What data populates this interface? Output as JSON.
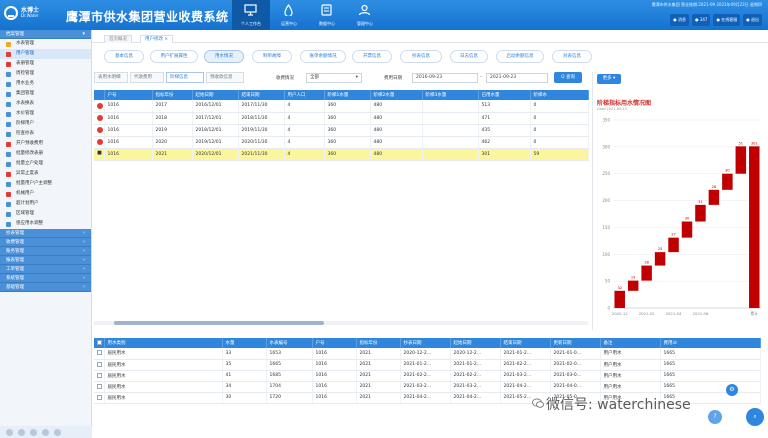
{
  "header": {
    "logo_cn": "水博士",
    "logo_en": "Dr.Water",
    "app_title": "鹰潭市供水集团营业收费系统",
    "nav": [
      {
        "label": "个人工作台",
        "icon": "monitor-icon",
        "active": true
      },
      {
        "label": "运营中心",
        "icon": "water-drop-icon",
        "active": false
      },
      {
        "label": "数据中心",
        "icon": "database-icon",
        "active": false
      },
      {
        "label": "管理中心",
        "icon": "users-icon",
        "active": false
      }
    ],
    "info_text": "鹰潭市供水集团  营业账期:2021-09  2021年09月23日 星期四",
    "buttons": [
      {
        "label": "消息",
        "icon": "bell-icon"
      },
      {
        "label": "347",
        "icon": "mail-icon"
      },
      {
        "label": "在线客服",
        "icon": "headset-icon"
      },
      {
        "label": "退出",
        "icon": "power-icon"
      }
    ]
  },
  "sidebar": {
    "sections_top": [
      {
        "label": "档案管理",
        "arrow": "▾"
      }
    ],
    "items": [
      {
        "label": "水表管理",
        "active": false,
        "color": "#f5a623"
      },
      {
        "label": "用户管理",
        "active": true,
        "color": "#e53935"
      },
      {
        "label": "表册管理",
        "active": false,
        "color": "#e53935"
      },
      {
        "label": "周检管理",
        "active": false,
        "color": "#4a90d9"
      },
      {
        "label": "用水业务",
        "active": false,
        "color": "#4a90d9"
      },
      {
        "label": "集团管理",
        "active": false,
        "color": "#4a90d9"
      },
      {
        "label": "水表换表",
        "active": false,
        "color": "#4a90d9"
      },
      {
        "label": "水价管理",
        "active": false,
        "color": "#4a90d9"
      },
      {
        "label": "阶梯用户",
        "active": false,
        "color": "#4a90d9"
      },
      {
        "label": "检查抄表",
        "active": false,
        "color": "#4a90d9"
      },
      {
        "label": "开户预收费用",
        "active": false,
        "color": "#e53935"
      },
      {
        "label": "批量修改表册",
        "active": false,
        "color": "#4a90d9"
      },
      {
        "label": "批量立户处理",
        "active": false,
        "color": "#4a90d9"
      },
      {
        "label": "异常止度表",
        "active": false,
        "color": "#e53935"
      },
      {
        "label": "批量用户户主调整",
        "active": false,
        "color": "#4a90d9"
      },
      {
        "label": "机械用户",
        "active": false,
        "color": "#e53935"
      },
      {
        "label": "超计划用户",
        "active": false,
        "color": "#4a90d9"
      },
      {
        "label": "区域管理",
        "active": false,
        "color": "#4a90d9"
      },
      {
        "label": "感应用水调整",
        "active": false,
        "color": "#4a90d9"
      }
    ],
    "sections_bottom": [
      {
        "label": "抄表管理",
        "arrow": "‹"
      },
      {
        "label": "收费管理",
        "arrow": "‹"
      },
      {
        "label": "账务管理",
        "arrow": "‹"
      },
      {
        "label": "报表管理",
        "arrow": "‹"
      },
      {
        "label": "工单管理",
        "arrow": "‹"
      },
      {
        "label": "系统管理",
        "arrow": "‹"
      },
      {
        "label": "基础管理",
        "arrow": "‹"
      }
    ]
  },
  "page_tabs": [
    {
      "label": "首页概况",
      "active": false
    },
    {
      "label": "用户修改 ×",
      "active": true
    }
  ],
  "pills": [
    {
      "label": "基本信息",
      "active": false
    },
    {
      "label": "用户扩展属性",
      "active": false
    },
    {
      "label": "用水情况",
      "active": true
    },
    {
      "label": "制单故障",
      "active": false
    },
    {
      "label": "账单余额情况",
      "active": false
    },
    {
      "label": "开票信息",
      "active": false
    },
    {
      "label": "抄表信息",
      "active": false
    },
    {
      "label": "日志信息",
      "active": false
    },
    {
      "label": "启动余额信息",
      "active": false
    },
    {
      "label": "对表信息",
      "active": false
    }
  ],
  "subtabs": [
    {
      "label": "表用水明细",
      "active": false
    },
    {
      "label": "代收费用",
      "active": false
    },
    {
      "label": "阶梯信息",
      "active": true
    },
    {
      "label": "预收款信息",
      "active": false
    }
  ],
  "filters": {
    "status_label": "收费情况",
    "status_value": "全部",
    "date_label": "费用日期",
    "date_from": "2016-09-23",
    "date_sep": "-",
    "date_to": "2021-09-23",
    "query_label": "Q 查询"
  },
  "main_table": {
    "headers": [
      "",
      "户号",
      "指标年份",
      "起始日期",
      "结束日期",
      "用户人口",
      "阶梯1水量",
      "阶梯2水量",
      "阶梯3水量",
      "已用水量",
      "阶梯水"
    ],
    "rows": [
      {
        "status": "red",
        "cells": [
          "1016",
          "2017",
          "2016/12/01",
          "2017/11/30",
          "4",
          "360",
          "480",
          "",
          "513",
          "0"
        ],
        "highlight": false
      },
      {
        "status": "red",
        "cells": [
          "1016",
          "2018",
          "2017/12/01",
          "2018/11/30",
          "4",
          "360",
          "480",
          "",
          "471",
          "0"
        ],
        "highlight": false
      },
      {
        "status": "red",
        "cells": [
          "1016",
          "2019",
          "2018/12/01",
          "2019/11/30",
          "4",
          "360",
          "480",
          "",
          "435",
          "0"
        ],
        "highlight": false
      },
      {
        "status": "red",
        "cells": [
          "1016",
          "2020",
          "2019/12/01",
          "2020/11/30",
          "4",
          "360",
          "480",
          "",
          "462",
          "0"
        ],
        "highlight": false
      },
      {
        "status": "warn",
        "cells": [
          "1016",
          "2021",
          "2020/12/01",
          "2021/11/30",
          "4",
          "360",
          "480",
          "",
          "301",
          "59"
        ],
        "highlight": true
      }
    ]
  },
  "chart_panel": {
    "button_label": "更多 ▾"
  },
  "chart_data": {
    "type": "bar",
    "title": "阶梯指标用水情况图",
    "subtitle": "Date:2021-09-23",
    "categories": [
      "2020-12",
      "2021-01",
      "2021-02",
      "2021-03",
      "2021-04",
      "2021-05",
      "2021-06",
      "2021-07",
      "2021-08",
      "2021-09",
      "累计"
    ],
    "x_tick_labels": [
      "2020-12",
      "2021-02",
      "2021-04",
      "2021-06",
      "累计"
    ],
    "values": [
      32,
      19,
      28,
      25,
      27,
      30,
      31,
      28,
      30,
      51,
      301
    ],
    "cumulative_tops": [
      32,
      51,
      79,
      104,
      131,
      161,
      192,
      220,
      250,
      301,
      301
    ],
    "ylim": [
      0,
      350
    ],
    "yticks": [
      0,
      50,
      100,
      150,
      200,
      250,
      300,
      350
    ],
    "bar_color": "#c00000",
    "grid": true
  },
  "bottom_table": {
    "headers": [
      "",
      "用水类别",
      "水量",
      "水表编号",
      "户号",
      "指标年份",
      "抄表日期",
      "起始日期",
      "结束日期",
      "更新日期",
      "备注",
      "费用id"
    ],
    "rows": [
      {
        "cells": [
          "居民用水",
          "33",
          "1653",
          "1016",
          "2021",
          "2020-12-2...",
          "2020-12-2...",
          "2021-01-2...",
          "2021-01-0...",
          "用户用水",
          "1665"
        ]
      },
      {
        "cells": [
          "居民用水",
          "35",
          "1665",
          "1016",
          "2021",
          "2021-01-2...",
          "2021-01-2...",
          "2021-02-2...",
          "2021-02-0...",
          "用户用水",
          "1665"
        ]
      },
      {
        "cells": [
          "居民用水",
          "41",
          "1685",
          "1016",
          "2021",
          "2021-02-2...",
          "2021-02-2...",
          "2021-03-2...",
          "2021-03-0...",
          "用户用水",
          "1665"
        ]
      },
      {
        "cells": [
          "居民用水",
          "34",
          "1704",
          "1016",
          "2021",
          "2021-03-2...",
          "2021-03-2...",
          "2021-04-2...",
          "2021-04-0...",
          "用户用水",
          "1665"
        ]
      },
      {
        "cells": [
          "居民用水",
          "30",
          "1720",
          "1016",
          "2021",
          "2021-04-2...",
          "2021-04-2...",
          "2021-05-2...",
          "2021-05-0...",
          "用户用水",
          "1665"
        ]
      }
    ]
  },
  "watermark": {
    "text": "微信号: waterchinese"
  }
}
